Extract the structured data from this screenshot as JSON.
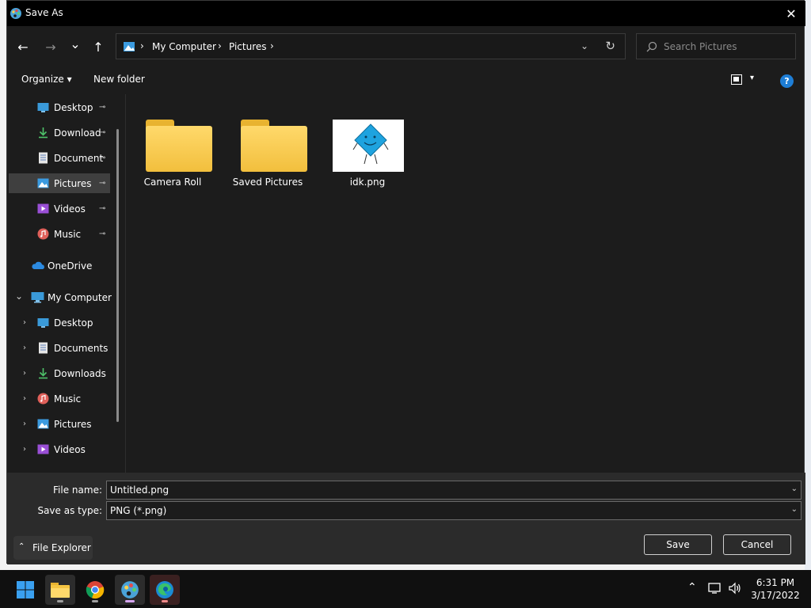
{
  "window": {
    "title": "Save As",
    "close_glyph": "✕"
  },
  "nav": {
    "back_glyph": "←",
    "forward_glyph": "→",
    "recent_glyph": "⌄",
    "up_glyph": "↑",
    "breadcrumbs": [
      "My Computer",
      "Pictures"
    ],
    "separator": "›",
    "refresh_glyph": "↻",
    "search_placeholder": "Search Pictures"
  },
  "toolbar": {
    "organize_label": "Organize ▾",
    "new_folder_label": "New folder",
    "help_label": "?",
    "view_dropdown_glyph": "▾"
  },
  "sidebar": {
    "quick_access": [
      {
        "label": "Desktop",
        "icon": "desktop-icon",
        "pinned": true
      },
      {
        "label": "Download",
        "icon": "download-icon",
        "pinned": true
      },
      {
        "label": "Document",
        "icon": "document-icon",
        "pinned": true
      },
      {
        "label": "Pictures",
        "icon": "pictures-icon",
        "pinned": true,
        "selected": true
      },
      {
        "label": "Videos",
        "icon": "videos-icon",
        "pinned": true
      },
      {
        "label": "Music",
        "icon": "music-icon",
        "pinned": true
      }
    ],
    "onedrive": "OneDrive",
    "my_computer": "My Computer",
    "computer_children": [
      {
        "label": "Desktop",
        "icon": "desktop-icon"
      },
      {
        "label": "Documents",
        "icon": "document-icon"
      },
      {
        "label": "Downloads",
        "icon": "download-icon"
      },
      {
        "label": "Music",
        "icon": "music-icon"
      },
      {
        "label": "Pictures",
        "icon": "pictures-icon"
      },
      {
        "label": "Videos",
        "icon": "videos-icon"
      }
    ],
    "pin_glyph": "📌",
    "expand_glyph": "›",
    "collapse_glyph": "⌄"
  },
  "files": [
    {
      "name": "Camera Roll",
      "type": "folder"
    },
    {
      "name": "Saved Pictures",
      "type": "folder"
    },
    {
      "name": "idk.png",
      "type": "image"
    }
  ],
  "bottom": {
    "file_name_label": "File name:",
    "file_name_value": "Untitled.png",
    "save_type_label": "Save as type:",
    "save_type_value": "PNG (*.png)",
    "dropdown_glyph": "⌄",
    "file_explorer_label": "File Explorer",
    "file_explorer_glyph": "⌃",
    "save_label": "Save",
    "cancel_label": "Cancel"
  },
  "taskbar": {
    "time": "6:31 PM",
    "date": "3/17/2022",
    "tray_chevron": "⌃",
    "speaker_glyph": "🔊"
  },
  "colors": {
    "dialog_bg": "#1c1c1c",
    "accent_blue": "#1e7ed6",
    "folder_yellow": "#f2bf3d"
  }
}
